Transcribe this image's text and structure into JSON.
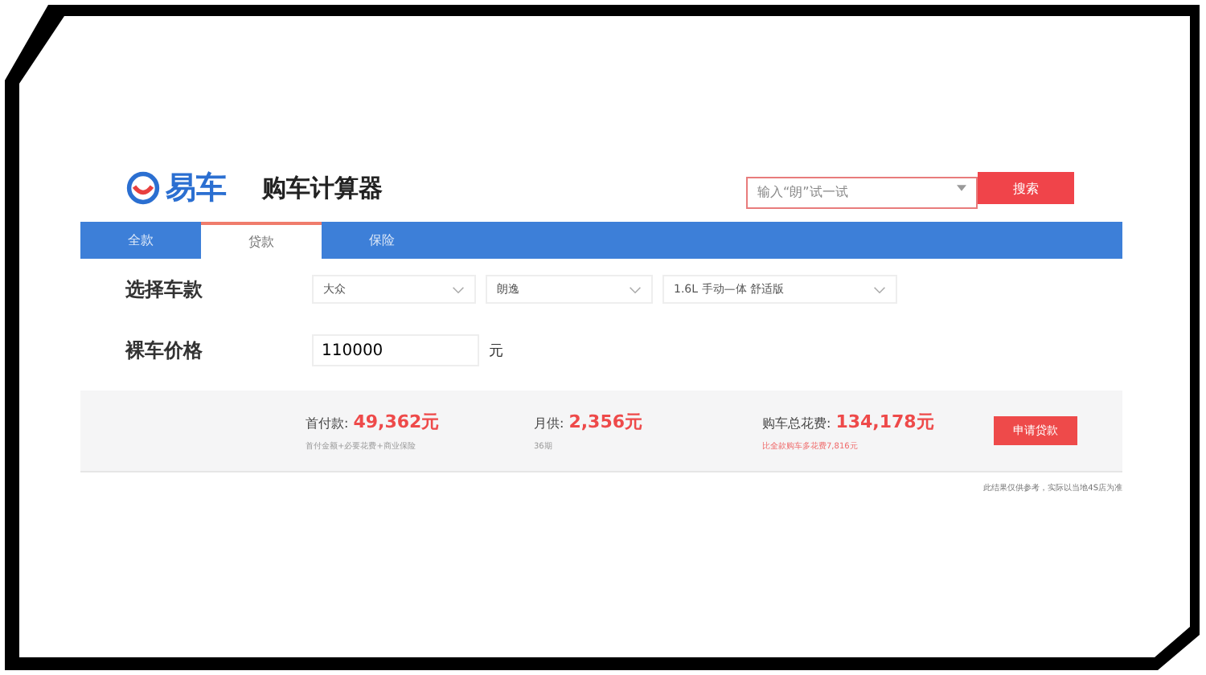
{
  "header": {
    "brand": "易车",
    "title": "购车计算器",
    "search": {
      "placeholder": "输入“朗”试一试"
    },
    "search_button": "搜索"
  },
  "tabs": [
    {
      "label": "全款",
      "selected": false
    },
    {
      "label": "贷款",
      "selected": true
    },
    {
      "label": "保险",
      "selected": false
    }
  ],
  "form": {
    "car_label": "选择车款",
    "selects": [
      "大众",
      "朗逸",
      "1.6L 手动—体 舒适版"
    ],
    "price_label": "裸车价格",
    "price_value": "110000",
    "price_unit": "元"
  },
  "results": [
    {
      "label": "首付款:",
      "value": "49,362元",
      "note": "首付金额+必要花费+商业保险",
      "kind": "plain"
    },
    {
      "label": "月供:",
      "value": "2,356元",
      "note": "36期",
      "kind": "plain"
    },
    {
      "label": "购车总花费:",
      "value": "134,178元",
      "note": "比全款购车多花费7,816元",
      "kind": "alert"
    }
  ],
  "apply_button": "申请贷款",
  "disclaimer": "此结果仅供参考，实际以当地4S店为准"
}
